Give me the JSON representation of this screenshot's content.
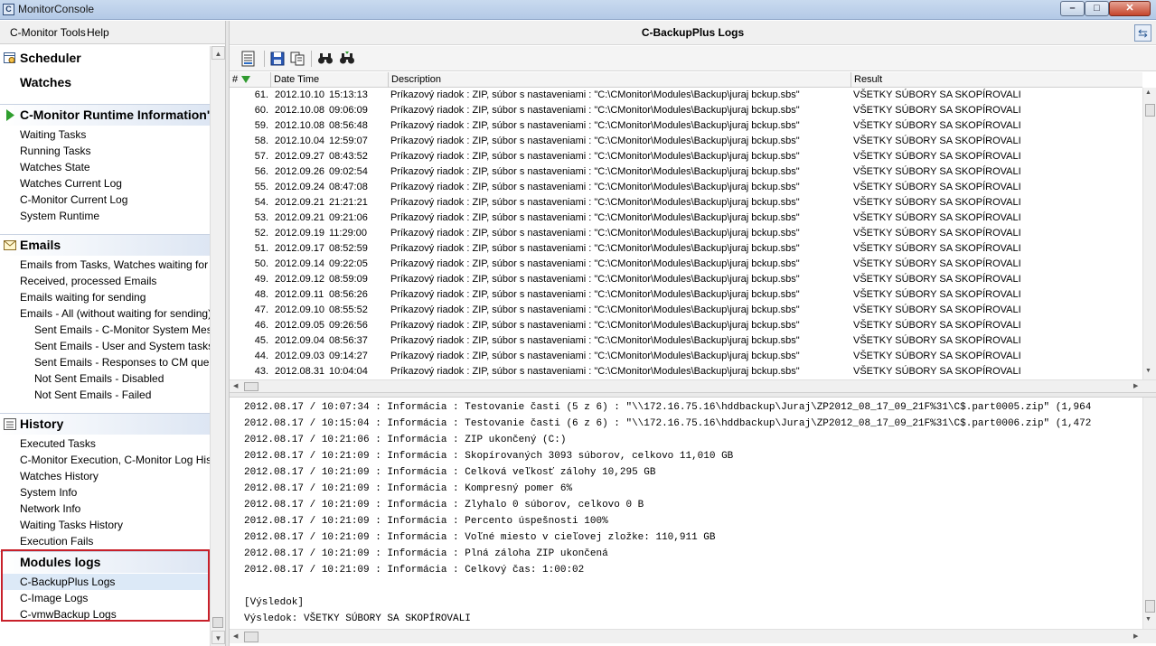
{
  "window": {
    "title": "MonitorConsole"
  },
  "menu": {
    "tools": "C-Monitor Tools",
    "help": "Help"
  },
  "nav": {
    "scheduler": "Scheduler",
    "watches": "Watches",
    "runtime": {
      "title": "C-Monitor Runtime Information'",
      "items": [
        "Waiting Tasks",
        "Running Tasks",
        "Watches State",
        "Watches Current Log",
        "C-Monitor Current Log",
        "System Runtime"
      ]
    },
    "emails": {
      "title": "Emails",
      "items": [
        "Emails from Tasks, Watches waiting for send",
        "Received, processed Emails",
        "Emails waiting for sending",
        "Emails - All (without waiting for sending)"
      ],
      "subitems": [
        "Sent Emails - C-Monitor System Message",
        "Sent Emails - User and System tasks Res",
        "Sent Emails - Responses to CM queries",
        "Not Sent Emails - Disabled",
        "Not Sent Emails - Failed"
      ]
    },
    "history": {
      "title": "History",
      "items": [
        "Executed Tasks",
        "C-Monitor Execution, C-Monitor Log History",
        "Watches History",
        "System Info",
        "Network Info",
        "Waiting Tasks History",
        "Execution Fails"
      ]
    },
    "modules": {
      "title": "Modules logs",
      "items": [
        "C-BackupPlus Logs",
        "C-Image Logs",
        "C-vmwBackup Logs"
      ],
      "selected_index": 0
    }
  },
  "panel": {
    "title": "C-BackupPlus Logs"
  },
  "grid": {
    "columns": {
      "num": "#",
      "datetime": "Date Time",
      "description": "Description",
      "result": "Result"
    },
    "rows": [
      {
        "num": "61.",
        "date": "2012.10.10",
        "time": "15:13:13",
        "desc": "Príkazový riadok : ZIP, súbor s nastaveniami : \"C:\\CMonitor\\Modules\\Backup\\juraj bckup.sbs\"",
        "result": "VŠETKY SÚBORY SA SKOPÍROVALI"
      },
      {
        "num": "60.",
        "date": "2012.10.08",
        "time": "09:06:09",
        "desc": "Príkazový riadok : ZIP, súbor s nastaveniami : \"C:\\CMonitor\\Modules\\Backup\\juraj bckup.sbs\"",
        "result": "VŠETKY SÚBORY SA SKOPÍROVALI"
      },
      {
        "num": "59.",
        "date": "2012.10.08",
        "time": "08:56:48",
        "desc": "Príkazový riadok : ZIP, súbor s nastaveniami : \"C:\\CMonitor\\Modules\\Backup\\juraj bckup.sbs\"",
        "result": "VŠETKY SÚBORY SA SKOPÍROVALI"
      },
      {
        "num": "58.",
        "date": "2012.10.04",
        "time": "12:59:07",
        "desc": "Príkazový riadok : ZIP, súbor s nastaveniami : \"C:\\CMonitor\\Modules\\Backup\\juraj bckup.sbs\"",
        "result": "VŠETKY SÚBORY SA SKOPÍROVALI"
      },
      {
        "num": "57.",
        "date": "2012.09.27",
        "time": "08:43:52",
        "desc": "Príkazový riadok : ZIP, súbor s nastaveniami : \"C:\\CMonitor\\Modules\\Backup\\juraj bckup.sbs\"",
        "result": "VŠETKY SÚBORY SA SKOPÍROVALI"
      },
      {
        "num": "56.",
        "date": "2012.09.26",
        "time": "09:02:54",
        "desc": "Príkazový riadok : ZIP, súbor s nastaveniami : \"C:\\CMonitor\\Modules\\Backup\\juraj bckup.sbs\"",
        "result": "VŠETKY SÚBORY SA SKOPÍROVALI"
      },
      {
        "num": "55.",
        "date": "2012.09.24",
        "time": "08:47:08",
        "desc": "Príkazový riadok : ZIP, súbor s nastaveniami : \"C:\\CMonitor\\Modules\\Backup\\juraj bckup.sbs\"",
        "result": "VŠETKY SÚBORY SA SKOPÍROVALI"
      },
      {
        "num": "54.",
        "date": "2012.09.21",
        "time": "21:21:21",
        "desc": "Príkazový riadok : ZIP, súbor s nastaveniami : \"C:\\CMonitor\\Modules\\Backup\\juraj bckup.sbs\"",
        "result": "VŠETKY SÚBORY SA SKOPÍROVALI"
      },
      {
        "num": "53.",
        "date": "2012.09.21",
        "time": "09:21:06",
        "desc": "Príkazový riadok : ZIP, súbor s nastaveniami : \"C:\\CMonitor\\Modules\\Backup\\juraj bckup.sbs\"",
        "result": "VŠETKY SÚBORY SA SKOPÍROVALI"
      },
      {
        "num": "52.",
        "date": "2012.09.19",
        "time": "11:29:00",
        "desc": "Príkazový riadok : ZIP, súbor s nastaveniami : \"C:\\CMonitor\\Modules\\Backup\\juraj bckup.sbs\"",
        "result": "VŠETKY SÚBORY SA SKOPÍROVALI"
      },
      {
        "num": "51.",
        "date": "2012.09.17",
        "time": "08:52:59",
        "desc": "Príkazový riadok : ZIP, súbor s nastaveniami : \"C:\\CMonitor\\Modules\\Backup\\juraj bckup.sbs\"",
        "result": "VŠETKY SÚBORY SA SKOPÍROVALI"
      },
      {
        "num": "50.",
        "date": "2012.09.14",
        "time": "09:22:05",
        "desc": "Príkazový riadok : ZIP, súbor s nastaveniami : \"C:\\CMonitor\\Modules\\Backup\\juraj bckup.sbs\"",
        "result": "VŠETKY SÚBORY SA SKOPÍROVALI"
      },
      {
        "num": "49.",
        "date": "2012.09.12",
        "time": "08:59:09",
        "desc": "Príkazový riadok : ZIP, súbor s nastaveniami : \"C:\\CMonitor\\Modules\\Backup\\juraj bckup.sbs\"",
        "result": "VŠETKY SÚBORY SA SKOPÍROVALI"
      },
      {
        "num": "48.",
        "date": "2012.09.11",
        "time": "08:56:26",
        "desc": "Príkazový riadok : ZIP, súbor s nastaveniami : \"C:\\CMonitor\\Modules\\Backup\\juraj bckup.sbs\"",
        "result": "VŠETKY SÚBORY SA SKOPÍROVALI"
      },
      {
        "num": "47.",
        "date": "2012.09.10",
        "time": "08:55:52",
        "desc": "Príkazový riadok : ZIP, súbor s nastaveniami : \"C:\\CMonitor\\Modules\\Backup\\juraj bckup.sbs\"",
        "result": "VŠETKY SÚBORY SA SKOPÍROVALI"
      },
      {
        "num": "46.",
        "date": "2012.09.05",
        "time": "09:26:56",
        "desc": "Príkazový riadok : ZIP, súbor s nastaveniami : \"C:\\CMonitor\\Modules\\Backup\\juraj bckup.sbs\"",
        "result": "VŠETKY SÚBORY SA SKOPÍROVALI"
      },
      {
        "num": "45.",
        "date": "2012.09.04",
        "time": "08:56:37",
        "desc": "Príkazový riadok : ZIP, súbor s nastaveniami : \"C:\\CMonitor\\Modules\\Backup\\juraj bckup.sbs\"",
        "result": "VŠETKY SÚBORY SA SKOPÍROVALI"
      },
      {
        "num": "44.",
        "date": "2012.09.03",
        "time": "09:14:27",
        "desc": "Príkazový riadok : ZIP, súbor s nastaveniami : \"C:\\CMonitor\\Modules\\Backup\\juraj bckup.sbs\"",
        "result": "VŠETKY SÚBORY SA SKOPÍROVALI"
      },
      {
        "num": "43.",
        "date": "2012.08.31",
        "time": "10:04:04",
        "desc": "Príkazový riadok : ZIP, súbor s nastaveniami : \"C:\\CMonitor\\Modules\\Backup\\juraj bckup.sbs\"",
        "result": "VŠETKY SÚBORY SA SKOPÍROVALI"
      }
    ]
  },
  "log": {
    "lines": [
      "2012.08.17 / 10:07:34 : Informácia : Testovanie časti (5 z 6) : \"\\\\172.16.75.16\\hddbackup\\Juraj\\ZP2012_08_17_09_21F%31\\C$.part0005.zip\" (1,964",
      "2012.08.17 / 10:15:04 : Informácia : Testovanie časti (6 z 6) : \"\\\\172.16.75.16\\hddbackup\\Juraj\\ZP2012_08_17_09_21F%31\\C$.part0006.zip\" (1,472",
      "2012.08.17 / 10:21:06 : Informácia : ZIP ukončený (C:)",
      "2012.08.17 / 10:21:09 : Informácia : Skopírovaných 3093 súborov, celkovo 11,010 GB",
      "2012.08.17 / 10:21:09 : Informácia : Celková veľkosť zálohy 10,295 GB",
      "2012.08.17 / 10:21:09 : Informácia : Kompresný pomer 6%",
      "2012.08.17 / 10:21:09 : Informácia : Zlyhalo 0 súborov, celkovo 0 B",
      "2012.08.17 / 10:21:09 : Informácia : Percento úspešnosti 100%",
      "2012.08.17 / 10:21:09 : Informácia : Voľné miesto v cieľovej zložke: 110,911 GB",
      "2012.08.17 / 10:21:09 : Informácia : Plná záloha ZIP ukončená",
      "2012.08.17 / 10:21:09 : Informácia : Celkový čas: 1:00:02",
      "",
      "[Výsledok]",
      "Výsledok: VŠETKY SÚBORY SA SKOPÍROVALI"
    ]
  },
  "colors": {
    "selection": "#dce9f7",
    "highlight_box": "#c8202a",
    "sort_arrow": "#2f9a2f"
  }
}
